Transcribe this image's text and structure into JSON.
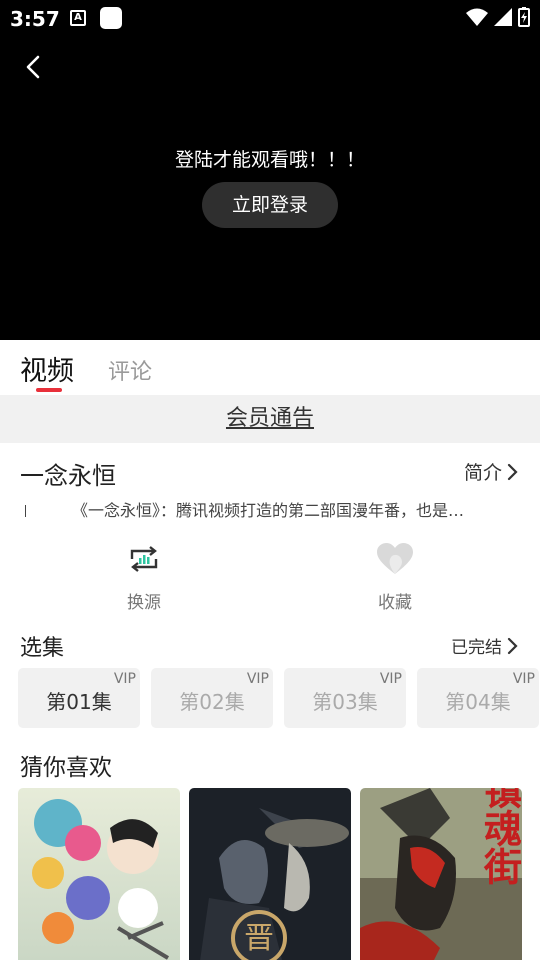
{
  "status_bar": {
    "time": "3:57",
    "icon_a": "A"
  },
  "player": {
    "login_message": "登陆才能观看哦！！！",
    "login_button": "立即登录"
  },
  "tabs": [
    {
      "label": "视频"
    },
    {
      "label": "评论"
    }
  ],
  "notice": "会员通告",
  "show": {
    "title": "一念永恒",
    "intro_label": "简介",
    "description": "《一念永恒》：腾讯视频打造的第二部国漫年番，也是…"
  },
  "actions": [
    {
      "label": "换源",
      "icon": "switch-source-icon"
    },
    {
      "label": "收藏",
      "icon": "heart-icon"
    }
  ],
  "episodes": {
    "title": "选集",
    "status": "已完结",
    "items": [
      {
        "label": "第01集",
        "badge": "VIP"
      },
      {
        "label": "第02集",
        "badge": "VIP"
      },
      {
        "label": "第03集",
        "badge": "VIP"
      },
      {
        "label": "第04集",
        "badge": "VIP"
      }
    ]
  },
  "recommend": {
    "title": "猜你喜欢",
    "poster_text_2": "晋",
    "poster_text_3": "镇魂街"
  },
  "colors": {
    "accent": "#e8303a",
    "player_bg": "#000000",
    "muted": "#9a9a9a"
  }
}
